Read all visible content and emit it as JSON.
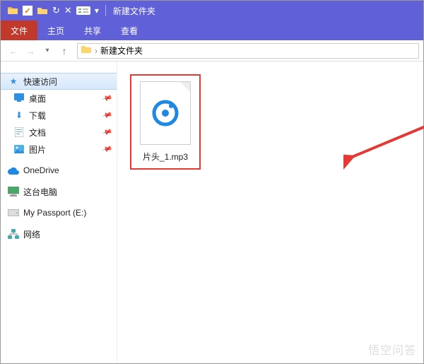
{
  "titlebar": {
    "window_title": "新建文件夹"
  },
  "ribbon": {
    "tabs": [
      {
        "label": "文件",
        "active": true
      },
      {
        "label": "主页",
        "active": false
      },
      {
        "label": "共享",
        "active": false
      },
      {
        "label": "查看",
        "active": false
      }
    ]
  },
  "address": {
    "path_segment": "新建文件夹"
  },
  "sidebar": {
    "quick_access": "快速访问",
    "items": [
      {
        "label": "桌面",
        "icon": "desktop",
        "pinned": true
      },
      {
        "label": "下载",
        "icon": "download",
        "pinned": true
      },
      {
        "label": "文档",
        "icon": "document",
        "pinned": true
      },
      {
        "label": "图片",
        "icon": "pictures",
        "pinned": true
      }
    ],
    "onedrive": "OneDrive",
    "this_pc": "这台电脑",
    "drive": "My Passport (E:)",
    "network": "网络"
  },
  "file": {
    "name": "片头_1.mp3"
  },
  "watermark": "悟空问答"
}
